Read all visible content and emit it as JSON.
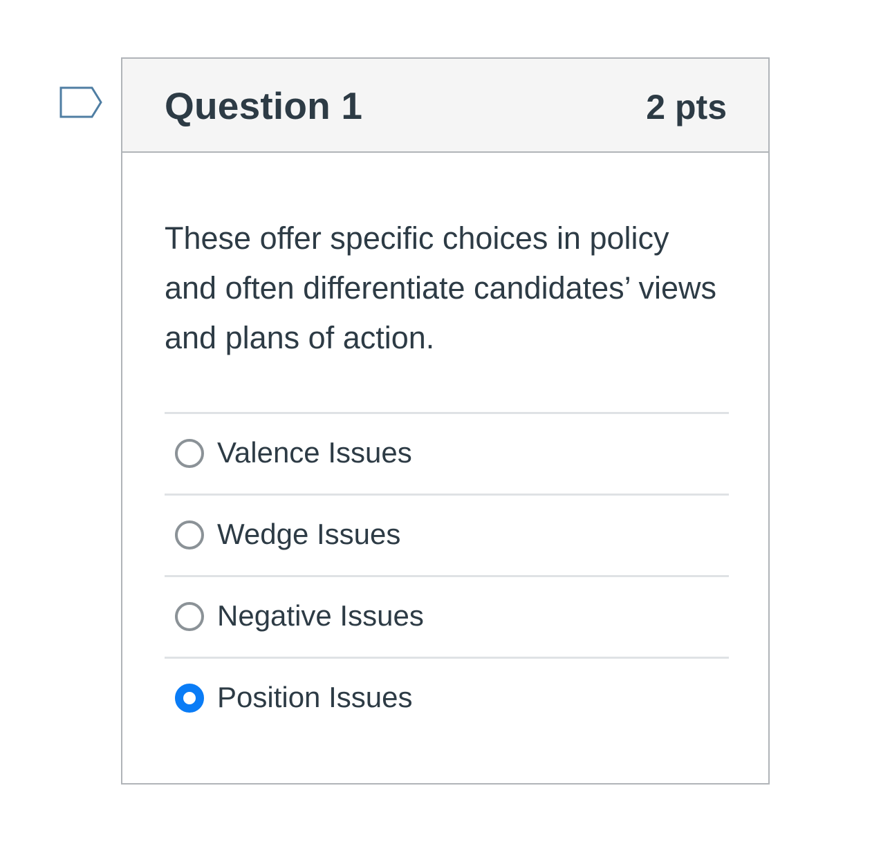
{
  "question": {
    "title": "Question 1",
    "points": "2 pts",
    "text": "These offer specific choices in policy and often differentiate candidates’ views and plans of action.",
    "flag_icon": "flag-question-icon"
  },
  "answers": [
    {
      "label": "Valence Issues",
      "selected": false
    },
    {
      "label": "Wedge Issues",
      "selected": false
    },
    {
      "label": "Negative Issues",
      "selected": false
    },
    {
      "label": "Position Issues",
      "selected": true
    }
  ],
  "colors": {
    "accent": "#0a7cf6",
    "text": "#2d3b45",
    "header_bg": "#f5f5f5",
    "border": "#b0b4b8",
    "flag": "#4f7ea3"
  }
}
